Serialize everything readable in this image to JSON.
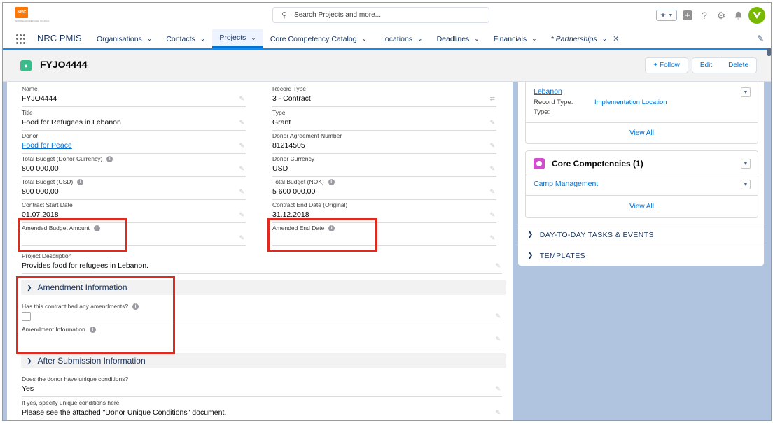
{
  "header": {
    "logo_text": "NRC",
    "logo_subtext": "NORWEGIAN REFUGEE COUNCIL",
    "search_placeholder": "Search Projects and more...",
    "avatar_initials": "V"
  },
  "nav": {
    "app_name": "NRC PMIS",
    "tabs": [
      {
        "label": "Organisations"
      },
      {
        "label": "Contacts"
      },
      {
        "label": "Projects"
      },
      {
        "label": "Core Competency Catalog"
      },
      {
        "label": "Locations"
      },
      {
        "label": "Deadlines"
      },
      {
        "label": "Financials"
      },
      {
        "label": "* Partnerships"
      }
    ]
  },
  "record": {
    "title": "FYJO4444",
    "follow_label": "+ Follow",
    "edit_label": "Edit",
    "delete_label": "Delete"
  },
  "fields": {
    "name": {
      "label": "Name",
      "value": "FYJO4444"
    },
    "record_type": {
      "label": "Record Type",
      "value": "3 - Contract"
    },
    "title": {
      "label": "Title",
      "value": "Food for Refugees in Lebanon"
    },
    "type": {
      "label": "Type",
      "value": "Grant"
    },
    "donor": {
      "label": "Donor",
      "value": "Food for Peace"
    },
    "donor_agreement": {
      "label": "Donor Agreement Number",
      "value": "81214505"
    },
    "total_budget_donor": {
      "label": "Total Budget (Donor Currency)",
      "value": "800 000,00"
    },
    "donor_currency": {
      "label": "Donor Currency",
      "value": "USD"
    },
    "total_budget_usd": {
      "label": "Total Budget (USD)",
      "value": "800 000,00"
    },
    "total_budget_nok": {
      "label": "Total Budget (NOK)",
      "value": "5 600 000,00"
    },
    "contract_start": {
      "label": "Contract Start Date",
      "value": "01.07.2018"
    },
    "contract_end": {
      "label": "Contract End Date (Original)",
      "value": "31.12.2018"
    },
    "amended_budget": {
      "label": "Amended Budget Amount",
      "value": ""
    },
    "amended_end": {
      "label": "Amended End Date",
      "value": ""
    },
    "project_description": {
      "label": "Project Description",
      "value": "Provides food for refugees in Lebanon."
    }
  },
  "amendment_section": {
    "title": "Amendment Information",
    "had_amendments_label": "Has this contract had any amendments?",
    "amendment_info_label": "Amendment Information"
  },
  "after_submission_section": {
    "title": "After Submission Information",
    "unique_conditions_label": "Does the donor have unique conditions?",
    "unique_conditions_value": "Yes",
    "specify_label": "If yes, specify unique conditions here",
    "specify_value": "Please see the attached \"Donor Unique Conditions\" document."
  },
  "sidebar": {
    "location_card": {
      "location_link": "Lebanon",
      "record_type_label": "Record Type:",
      "record_type_value": "Implementation Location",
      "type_label": "Type:",
      "view_all": "View All"
    },
    "core_competencies": {
      "title": "Core Competencies (1)",
      "item": "Camp Management",
      "view_all": "View All"
    },
    "sections": [
      {
        "label": "DAY-TO-DAY TASKS & EVENTS"
      },
      {
        "label": "TEMPLATES"
      }
    ]
  }
}
